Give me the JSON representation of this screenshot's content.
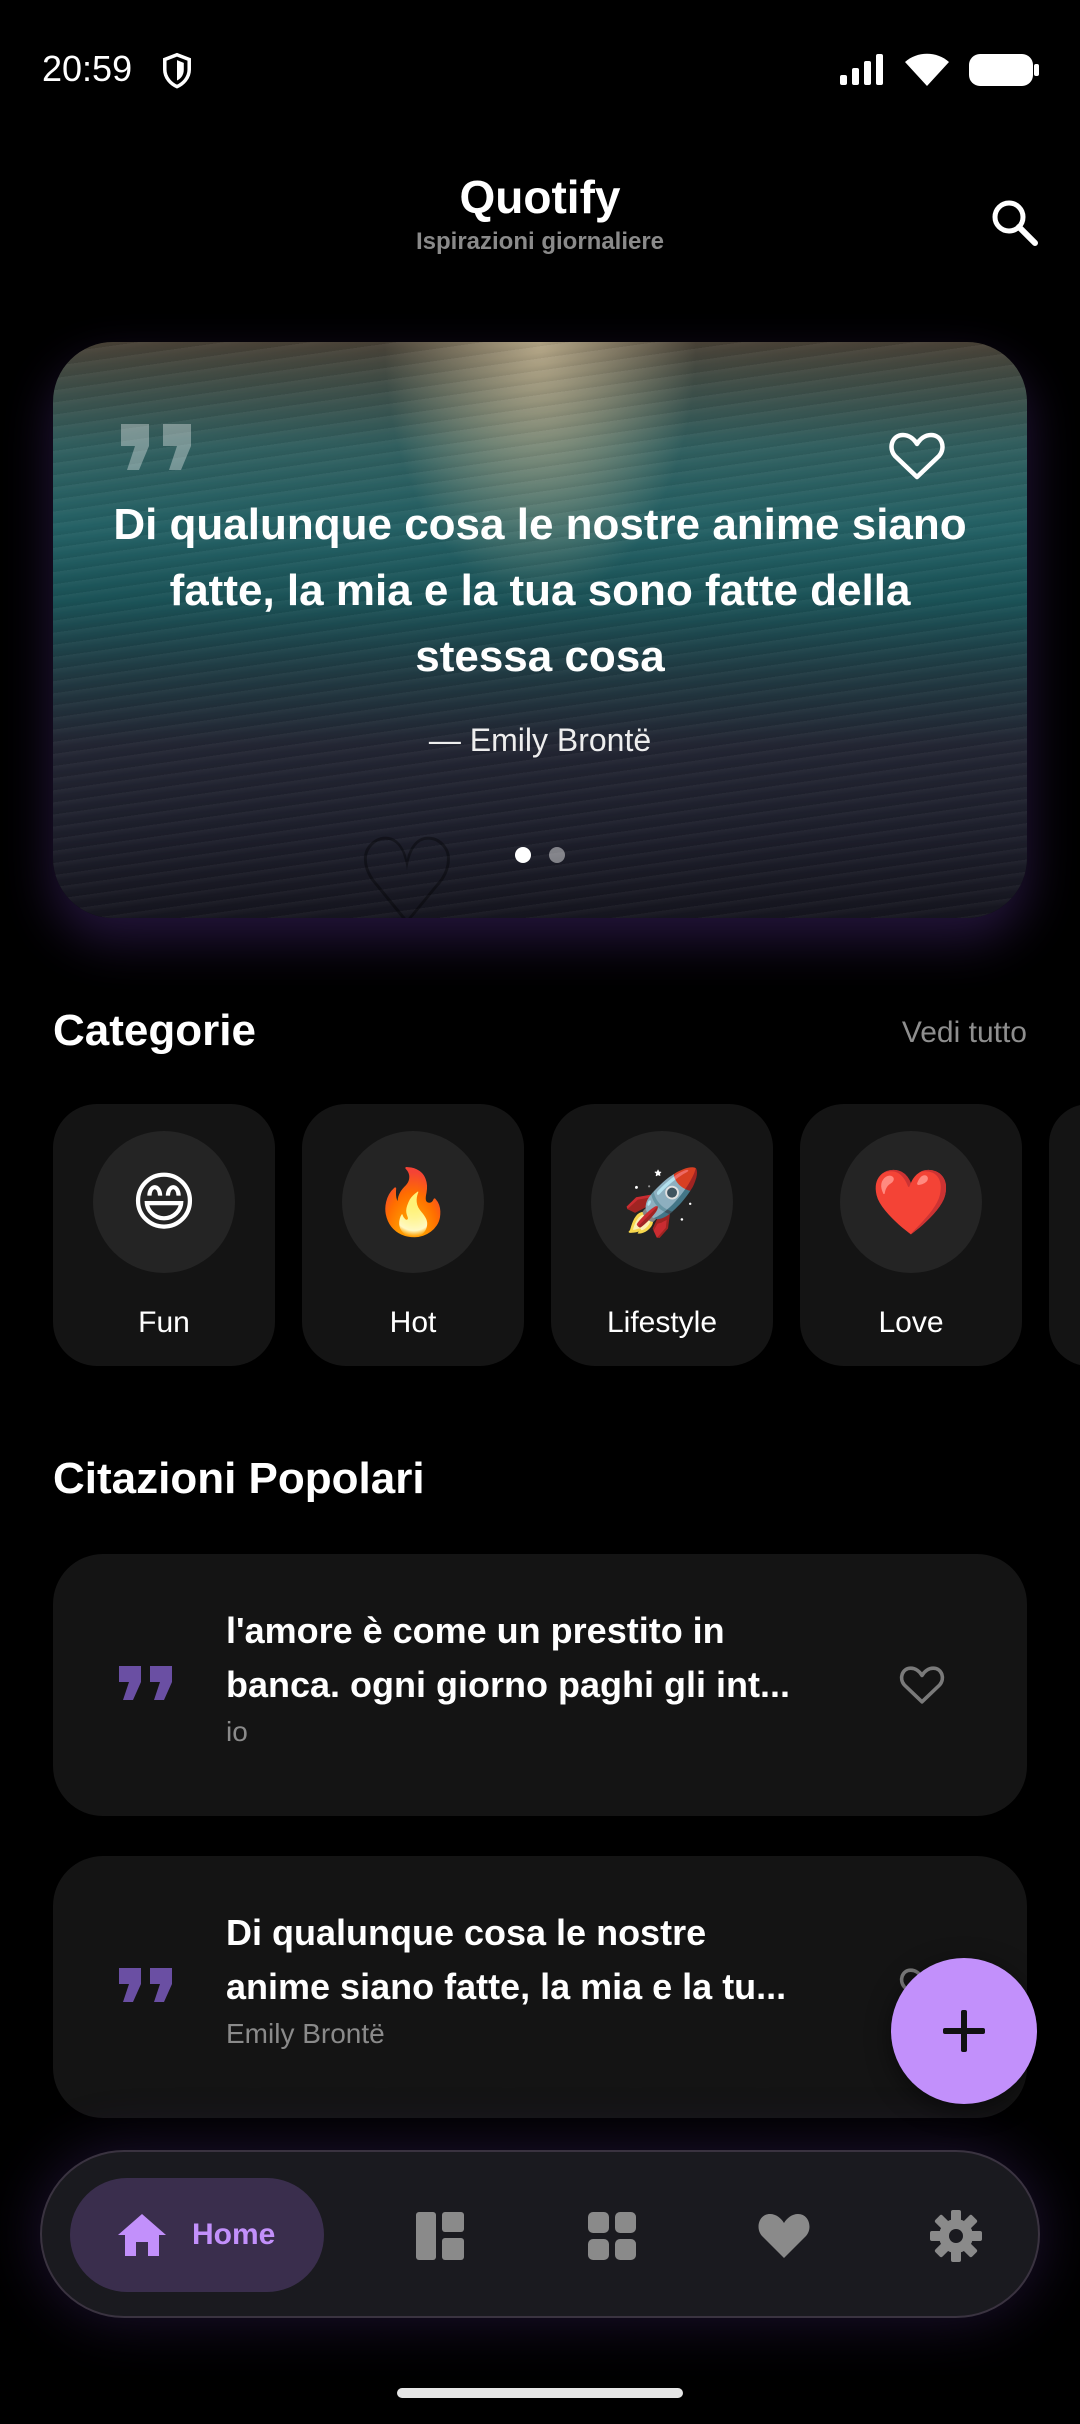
{
  "status_bar": {
    "time": "20:59"
  },
  "header": {
    "title": "Quotify",
    "subtitle": "Ispirazioni giornaliere"
  },
  "featured": {
    "text": "Di qualunque cosa le nostre anime siano fatte, la mia e la tua sono fatte della stessa cosa",
    "author": "— Emily Brontë",
    "page_count": 2,
    "active_page": 1
  },
  "categories": {
    "title": "Categorie",
    "see_all": "Vedi tutto",
    "items": [
      {
        "emoji": "😄",
        "label": "Fun"
      },
      {
        "emoji": "🔥",
        "label": "Hot"
      },
      {
        "emoji": "🚀",
        "label": "Lifestyle"
      },
      {
        "emoji": "❤️",
        "label": "Love"
      }
    ]
  },
  "popular": {
    "title": "Citazioni Popolari",
    "items": [
      {
        "line1": "l'amore è come un prestito in",
        "line2": "banca.  ogni giorno paghi gli int...",
        "author": "io"
      },
      {
        "line1": "Di qualunque cosa le nostre",
        "line2": "anime siano fatte, la mia e la tu...",
        "author": "Emily Brontë"
      }
    ]
  },
  "nav": {
    "home_label": "Home"
  },
  "colors": {
    "accent": "#c290fb",
    "card": "#141414",
    "background": "#000000"
  }
}
